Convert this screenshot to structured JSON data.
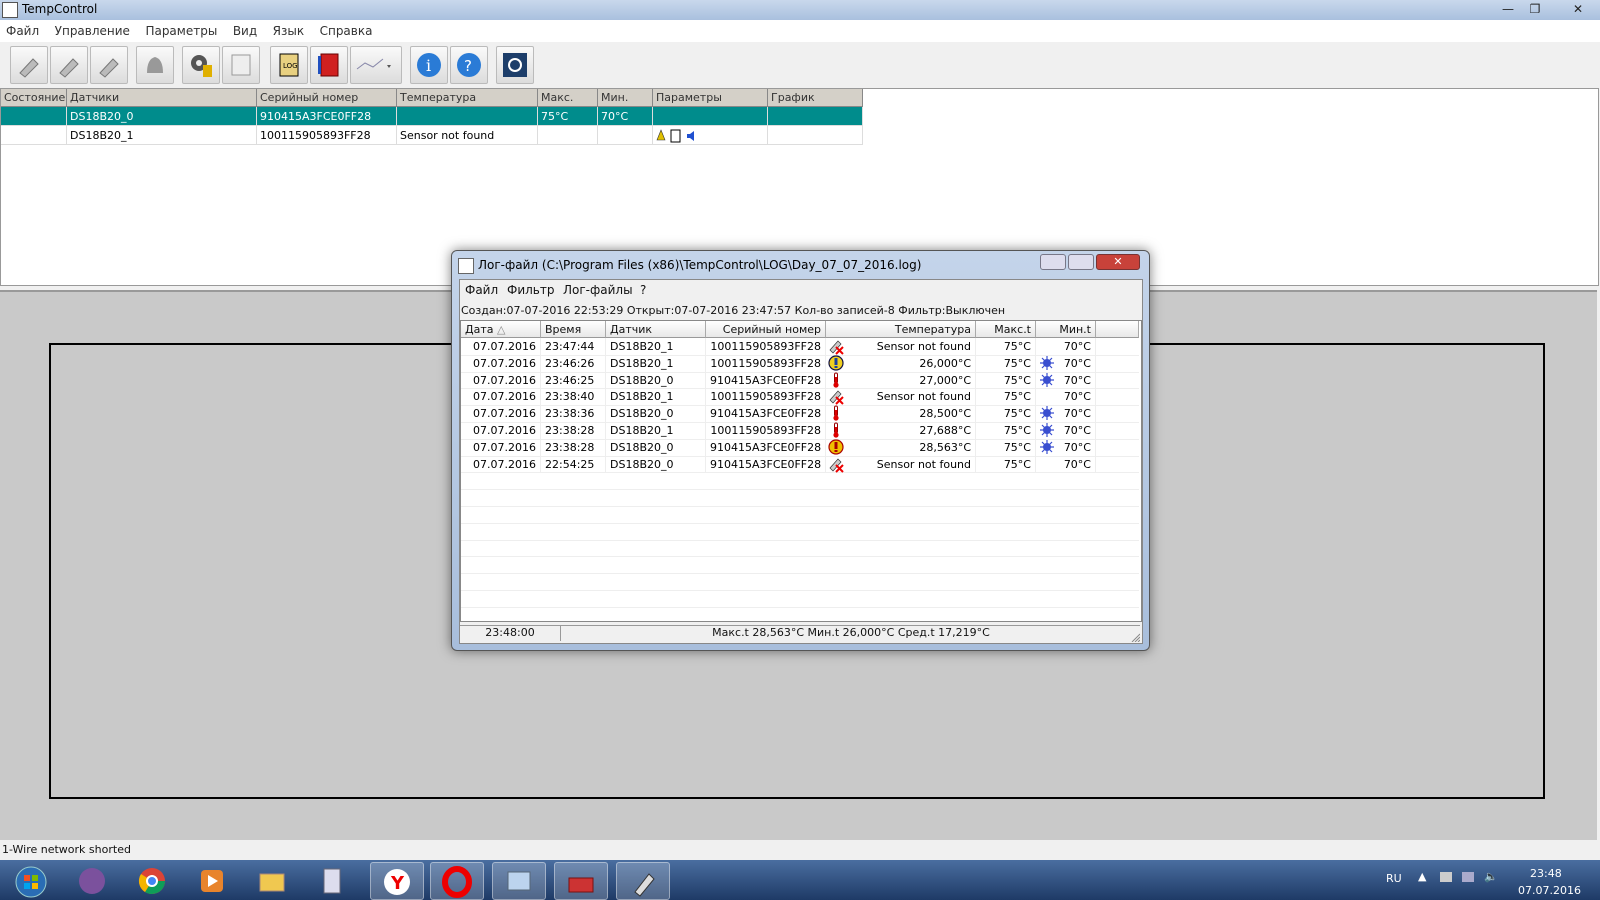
{
  "app": {
    "title": "TempControl",
    "menu": [
      "Файл",
      "Управление",
      "Параметры",
      "Вид",
      "Язык",
      "Справка"
    ]
  },
  "toolbar": {
    "icons": [
      "sensor-search-icon",
      "sensor-add-icon",
      "sensor-remove-icon",
      "alarm-bell-icon",
      "settings-gear-icon",
      "edit-note-icon",
      "log-notebook-icon",
      "red-book-icon",
      "chart-dropdown-icon",
      "info-icon",
      "help-icon",
      "power-icon"
    ]
  },
  "sensor_table": {
    "headers": [
      "Состояние",
      "Датчики",
      "Серийный номер",
      "Температура",
      "Макс.",
      "Мин.",
      "Параметры",
      "График"
    ],
    "rows": [
      {
        "state": "",
        "name": "DS18B20_0",
        "serial": "910415A3FCE0FF28",
        "temp": "",
        "max": "75°C",
        "min": "70°C",
        "params": "",
        "graph": ""
      },
      {
        "state": "",
        "name": "DS18B20_1",
        "serial": "100115905893FF28",
        "temp": "Sensor not found",
        "max": "",
        "min": "",
        "params": "",
        "graph": ""
      }
    ]
  },
  "status": {
    "text": "1-Wire network shorted"
  },
  "log_dialog": {
    "title": "Лог-файл (C:\\Program Files (x86)\\TempControl\\LOG\\Day_07_07_2016.log)",
    "menu": [
      "Файл",
      "Фильтр",
      "Лог-файлы",
      "?"
    ],
    "info": "Создан:07-07-2016 22:53:29 Открыт:07-07-2016 23:47:57 Кол-во записей-8 Фильтр:Выключен",
    "headers": [
      "Дата",
      "Время",
      "Датчик",
      "Серийный номер",
      "Температура",
      "Макс.t",
      "Мин.t"
    ],
    "rows": [
      {
        "date": "07.07.2016",
        "time": "23:47:44",
        "sensor": "DS18B20_1",
        "serial": "100115905893FF28",
        "icon": "sensor-error-icon",
        "temp": "Sensor not found",
        "max": "75°C",
        "alarm": false,
        "min": "70°C"
      },
      {
        "date": "07.07.2016",
        "time": "23:46:26",
        "sensor": "DS18B20_1",
        "serial": "100115905893FF28",
        "icon": "warning-blue-icon",
        "temp": "26,000°C",
        "max": "75°C",
        "alarm": true,
        "min": "70°C"
      },
      {
        "date": "07.07.2016",
        "time": "23:46:25",
        "sensor": "DS18B20_0",
        "serial": "910415A3FCE0FF28",
        "icon": "thermometer-icon",
        "temp": "27,000°C",
        "max": "75°C",
        "alarm": true,
        "min": "70°C"
      },
      {
        "date": "07.07.2016",
        "time": "23:38:40",
        "sensor": "DS18B20_1",
        "serial": "100115905893FF28",
        "icon": "sensor-error-icon",
        "temp": "Sensor not found",
        "max": "75°C",
        "alarm": false,
        "min": "70°C"
      },
      {
        "date": "07.07.2016",
        "time": "23:38:36",
        "sensor": "DS18B20_0",
        "serial": "910415A3FCE0FF28",
        "icon": "thermometer-icon",
        "temp": "28,500°C",
        "max": "75°C",
        "alarm": true,
        "min": "70°C"
      },
      {
        "date": "07.07.2016",
        "time": "23:38:28",
        "sensor": "DS18B20_1",
        "serial": "100115905893FF28",
        "icon": "thermometer-icon",
        "temp": "27,688°C",
        "max": "75°C",
        "alarm": true,
        "min": "70°C"
      },
      {
        "date": "07.07.2016",
        "time": "23:38:28",
        "sensor": "DS18B20_0",
        "serial": "910415A3FCE0FF28",
        "icon": "warning-yellow-icon",
        "temp": "28,563°C",
        "max": "75°C",
        "alarm": true,
        "min": "70°C"
      },
      {
        "date": "07.07.2016",
        "time": "22:54:25",
        "sensor": "DS18B20_0",
        "serial": "910415A3FCE0FF28",
        "icon": "sensor-error-icon",
        "temp": "Sensor not found",
        "max": "75°C",
        "alarm": false,
        "min": "70°C"
      }
    ],
    "status_time": "23:48:00",
    "status_stats": "Макс.t 28,563°C Мин.t 26,000°C Сред.t 17,219°C"
  },
  "taskbar": {
    "apps": [
      "start-orb-icon",
      "viber-icon",
      "chrome-icon",
      "media-player-icon",
      "explorer-folder-icon",
      "calculator-icon",
      "yandex-browser-icon",
      "opera-icon",
      "control-panel-icon",
      "toolbox-icon",
      "tempcontrol-icon"
    ],
    "lang": "RU",
    "time": "23:48",
    "date": "07.07.2016"
  },
  "colors": {
    "selection": "#008c8c",
    "taskbar": "#2a4a7a",
    "title_bar": "#b8cce6"
  }
}
